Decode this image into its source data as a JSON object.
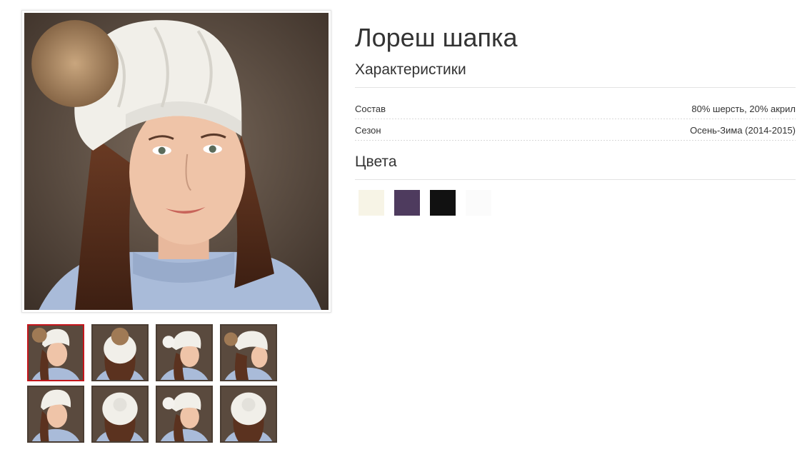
{
  "product": {
    "title": "Лореш шапка"
  },
  "specs": {
    "heading": "Характеристики",
    "rows": [
      {
        "label": "Состав",
        "value": "80% шерсть, 20% акрил"
      },
      {
        "label": "Сезон",
        "value": "Осень-Зима (2014-2015)"
      }
    ]
  },
  "colors": {
    "heading": "Цвета",
    "swatches": [
      "#f7f4e6",
      "#4e3b5e",
      "#111111",
      "#fbfbfb"
    ]
  },
  "gallery": {
    "main_photo": "woman-in-white-knit-hat-with-fur-pompom",
    "active_thumb_border": "#c4161c",
    "thumbnails": [
      {
        "view": "front-pompom",
        "active": true
      },
      {
        "view": "back-pompom",
        "active": false
      },
      {
        "view": "side-white-pompom",
        "active": false
      },
      {
        "view": "side-fur-pompom",
        "active": false
      },
      {
        "view": "front-no-pompom",
        "active": false
      },
      {
        "view": "back-no-pompom",
        "active": false
      },
      {
        "view": "side-white-pompom-2",
        "active": false
      },
      {
        "view": "back-slouch",
        "active": false
      }
    ]
  }
}
